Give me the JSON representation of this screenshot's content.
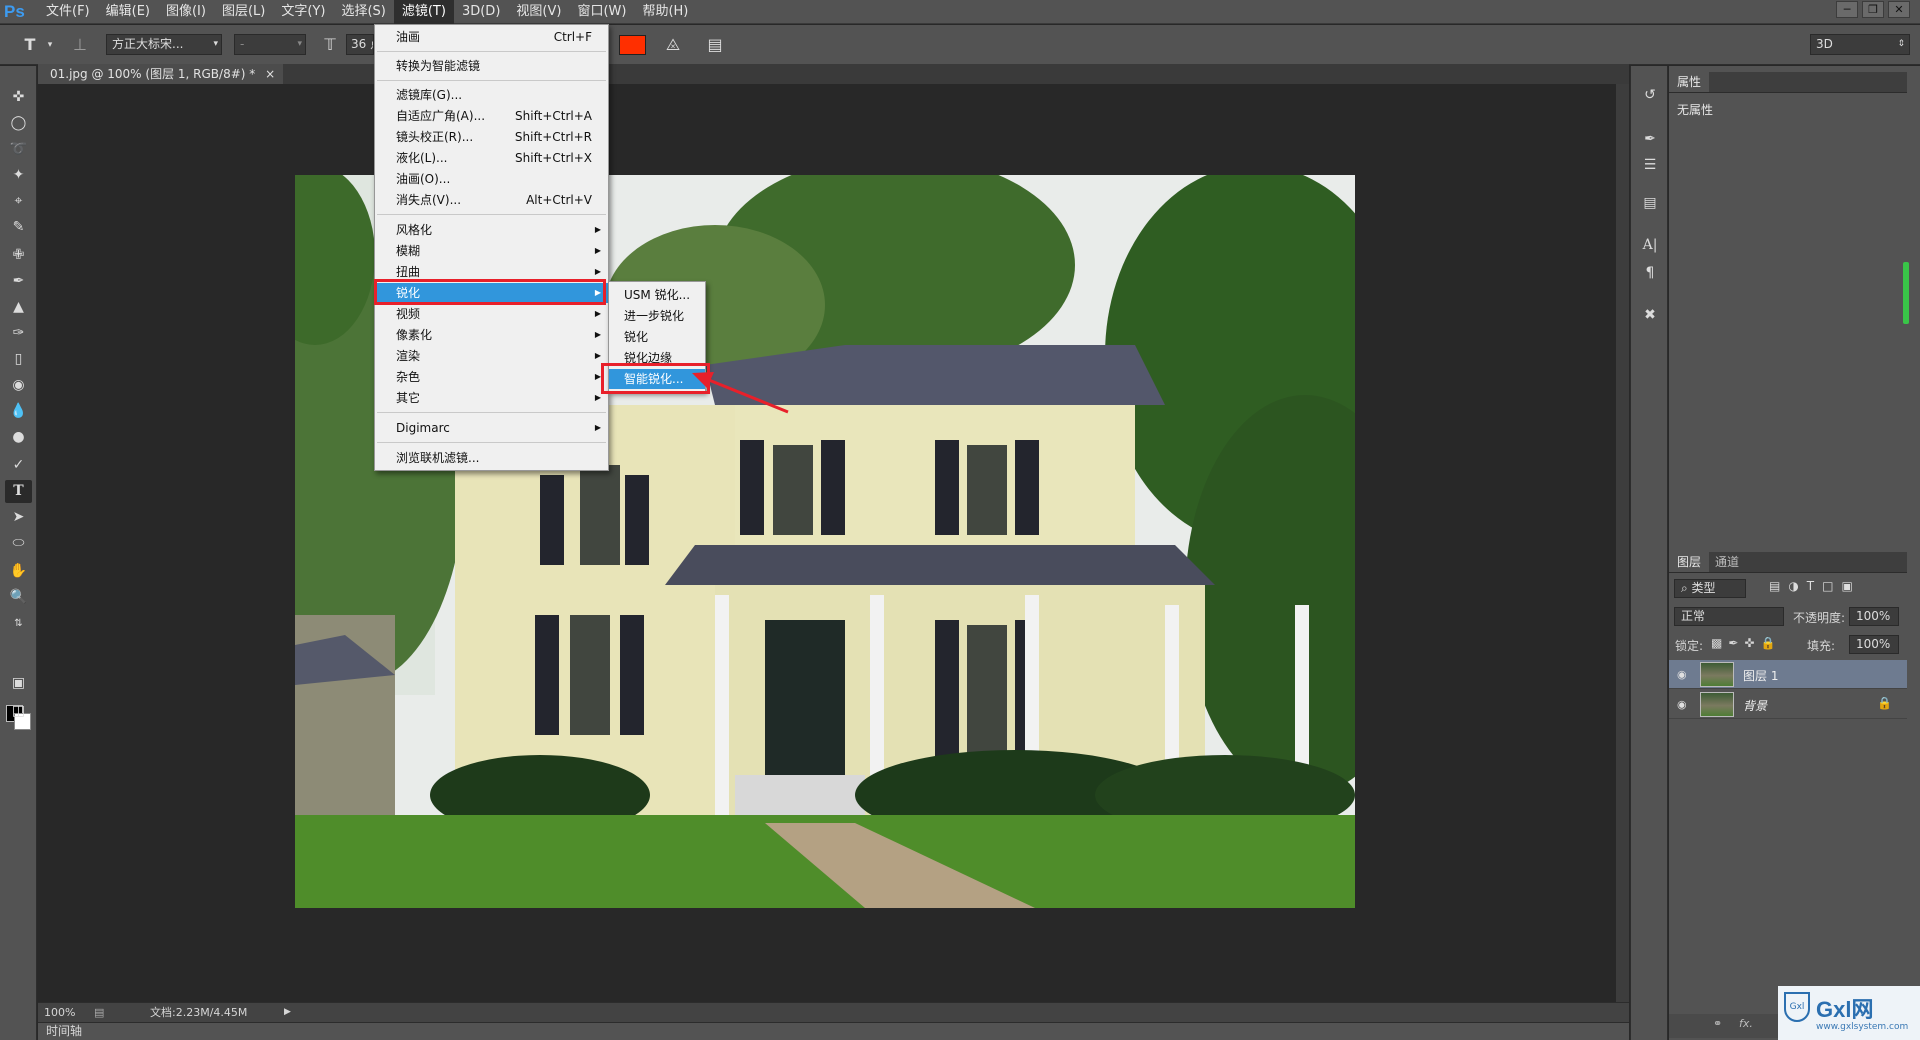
{
  "app": {
    "logo": "Ps"
  },
  "menubar": {
    "items": [
      "文件(F)",
      "编辑(E)",
      "图像(I)",
      "图层(L)",
      "文字(Y)",
      "选择(S)",
      "滤镜(T)",
      "3D(D)",
      "视图(V)",
      "窗口(W)",
      "帮助(H)"
    ],
    "active_index": 6
  },
  "window_controls": [
    "minimize-icon",
    "restore-icon",
    "close-icon"
  ],
  "options_bar": {
    "tool_icon": "type-tool-icon",
    "font_family": "方正大标宋...",
    "font_style": "-",
    "font_size": "36 点",
    "text_color": "#ff2f00",
    "workspace": "3D"
  },
  "document": {
    "tab_title": "01.jpg @ 100% (图层 1, RGB/8#) *",
    "zoom": "100%",
    "doc_info": "文档:2.23M/4.45M"
  },
  "timeline": {
    "label": "时间轴"
  },
  "filter_menu": {
    "items": [
      {
        "label": "油画",
        "shortcut": "Ctrl+F"
      },
      {
        "label": "转换为智能滤镜"
      },
      {
        "label": "滤镜库(G)..."
      },
      {
        "label": "自适应广角(A)...",
        "shortcut": "Shift+Ctrl+A"
      },
      {
        "label": "镜头校正(R)...",
        "shortcut": "Shift+Ctrl+R"
      },
      {
        "label": "液化(L)...",
        "shortcut": "Shift+Ctrl+X"
      },
      {
        "label": "油画(O)..."
      },
      {
        "label": "消失点(V)...",
        "shortcut": "Alt+Ctrl+V"
      },
      {
        "label": "风格化",
        "submenu": true
      },
      {
        "label": "模糊",
        "submenu": true
      },
      {
        "label": "扭曲",
        "submenu": true
      },
      {
        "label": "锐化",
        "submenu": true,
        "highlighted": true
      },
      {
        "label": "视频",
        "submenu": true
      },
      {
        "label": "像素化",
        "submenu": true
      },
      {
        "label": "渲染",
        "submenu": true
      },
      {
        "label": "杂色",
        "submenu": true
      },
      {
        "label": "其它",
        "submenu": true
      },
      {
        "label": "Digimarc",
        "submenu": true
      },
      {
        "label": "浏览联机滤镜..."
      }
    ]
  },
  "sharpen_submenu": {
    "items": [
      {
        "label": "USM 锐化..."
      },
      {
        "label": "进一步锐化"
      },
      {
        "label": "锐化"
      },
      {
        "label": "锐化边缘"
      },
      {
        "label": "智能锐化...",
        "highlighted": true
      }
    ]
  },
  "properties_panel": {
    "tab": "属性",
    "content": "无属性"
  },
  "layers_panel": {
    "tabs": [
      "图层",
      "通道"
    ],
    "filter_kind": "类型",
    "blend_mode": "正常",
    "opacity_label": "不透明度:",
    "opacity": "100%",
    "lock_label": "锁定:",
    "fill_label": "填充:",
    "fill": "100%",
    "layers": [
      {
        "name": "图层 1",
        "selected": true
      },
      {
        "name": "背景",
        "locked": true
      }
    ]
  },
  "watermark": {
    "text": "Gxl网",
    "url": "www.gxlsystem.com"
  },
  "colors": {
    "highlight": "#3196dc",
    "annotation_red": "#e8202a",
    "accent_blue": "#3d9bf0"
  }
}
